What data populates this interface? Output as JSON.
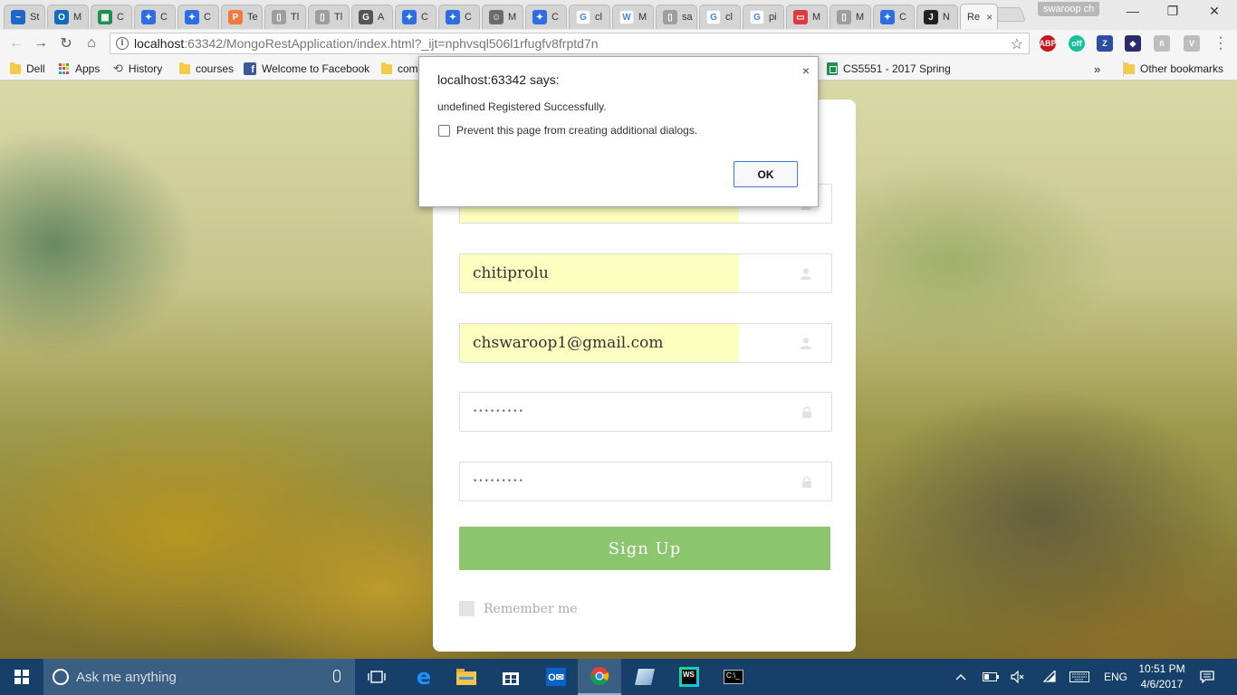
{
  "browser": {
    "tabs": [
      {
        "title": "St",
        "favicon_color": "#1e66c9",
        "favicon_glyph": "~"
      },
      {
        "title": "M",
        "favicon_color": "#0f6cbd",
        "favicon_glyph": "O"
      },
      {
        "title": "C",
        "favicon_color": "#1e8f4d",
        "favicon_glyph": "▦"
      },
      {
        "title": "C",
        "favicon_color": "#2f6ee2",
        "favicon_glyph": "✦"
      },
      {
        "title": "C",
        "favicon_color": "#2f6ee2",
        "favicon_glyph": "✦"
      },
      {
        "title": "Te",
        "favicon_color": "#f07b3f",
        "favicon_glyph": "P"
      },
      {
        "title": "Tl",
        "favicon_color": "#9e9e9e",
        "favicon_glyph": "▯"
      },
      {
        "title": "Tl",
        "favicon_color": "#9e9e9e",
        "favicon_glyph": "▯"
      },
      {
        "title": "A",
        "favicon_color": "#555555",
        "favicon_glyph": "G"
      },
      {
        "title": "C",
        "favicon_color": "#2f6ee2",
        "favicon_glyph": "✦"
      },
      {
        "title": "C",
        "favicon_color": "#2f6ee2",
        "favicon_glyph": "✦"
      },
      {
        "title": "M",
        "favicon_color": "#6b6b6b",
        "favicon_glyph": "☺"
      },
      {
        "title": "C",
        "favicon_color": "#2f6ee2",
        "favicon_glyph": "✦"
      },
      {
        "title": "cl",
        "favicon_color": "#ffffff",
        "favicon_glyph": "G"
      },
      {
        "title": "M",
        "favicon_color": "#ffffff",
        "favicon_glyph": "W"
      },
      {
        "title": "sa",
        "favicon_color": "#9e9e9e",
        "favicon_glyph": "▯"
      },
      {
        "title": "cl",
        "favicon_color": "#ffffff",
        "favicon_glyph": "G"
      },
      {
        "title": "pi",
        "favicon_color": "#ffffff",
        "favicon_glyph": "G"
      },
      {
        "title": "M",
        "favicon_color": "#e0393e",
        "favicon_glyph": "▭"
      },
      {
        "title": "M",
        "favicon_color": "#9e9e9e",
        "favicon_glyph": "▯"
      },
      {
        "title": "C",
        "favicon_color": "#2f6ee2",
        "favicon_glyph": "✦"
      },
      {
        "title": "N",
        "favicon_color": "#222222",
        "favicon_glyph": "J"
      }
    ],
    "active_tab": {
      "title": "Re",
      "close": "×"
    },
    "profile_name": "swaroop ch",
    "window_controls": {
      "minimize": "—",
      "maximize": "❐",
      "close": "✕"
    },
    "nav": {
      "back": "←",
      "forward": "→",
      "reload": "↻",
      "home": "⌂"
    },
    "url_host": "localhost",
    "url_rest": ":63342/MongoRestApplication/index.html?_ijt=nphvsql506l1rfugfv8frptd7n",
    "extensions": [
      {
        "name": "abp-icon",
        "label": "ABP",
        "color": "#c7161e"
      },
      {
        "name": "grammarly-icon",
        "label": "off",
        "color": "#15c39a"
      },
      {
        "name": "zotero-icon",
        "label": "Z",
        "color": "#2b4ea2"
      },
      {
        "name": "wappalyzer-icon",
        "label": "◆",
        "color": "#2a2c6e"
      },
      {
        "name": "extension-gray-icon",
        "label": "ñ",
        "color": "#bdbdbd"
      },
      {
        "name": "shield-ext-icon",
        "label": "V",
        "color": "#bdbdbd"
      }
    ],
    "bookmarks": [
      {
        "label": "Dell",
        "icon": "folder"
      },
      {
        "label": "Apps",
        "icon": "apps"
      },
      {
        "label": "History",
        "icon": "history"
      },
      {
        "label": "courses",
        "icon": "folder"
      },
      {
        "label": "Welcome to Facebook",
        "icon": "facebook"
      },
      {
        "label": "com",
        "icon": "folder"
      },
      {
        "label": "CS5551 - 2017 Spring",
        "icon": "sheets"
      }
    ],
    "bookmarks_overflow": "»",
    "other_bookmarks": "Other bookmarks"
  },
  "form": {
    "fields": [
      {
        "value": "",
        "type": "text",
        "autofill": true
      },
      {
        "value": "chitiprolu",
        "type": "text",
        "autofill": true
      },
      {
        "value": "chswaroop1@gmail.com",
        "type": "email",
        "autofill": true
      },
      {
        "value": "•••••••••",
        "type": "password",
        "autofill": false
      },
      {
        "value": "•••••••••",
        "type": "password",
        "autofill": false
      }
    ],
    "signup_label": "Sign Up",
    "remember_label": "Remember me",
    "accent_color": "#8bc56d"
  },
  "dialog": {
    "title": "localhost:63342 says:",
    "message": "undefined Registered Successfully.",
    "checkbox_label": "Prevent this page from creating additional dialogs.",
    "ok_label": "OK",
    "close": "×"
  },
  "taskbar": {
    "search_placeholder": "Ask me anything",
    "language": "ENG",
    "time": "10:51 PM",
    "date": "4/6/2017"
  }
}
